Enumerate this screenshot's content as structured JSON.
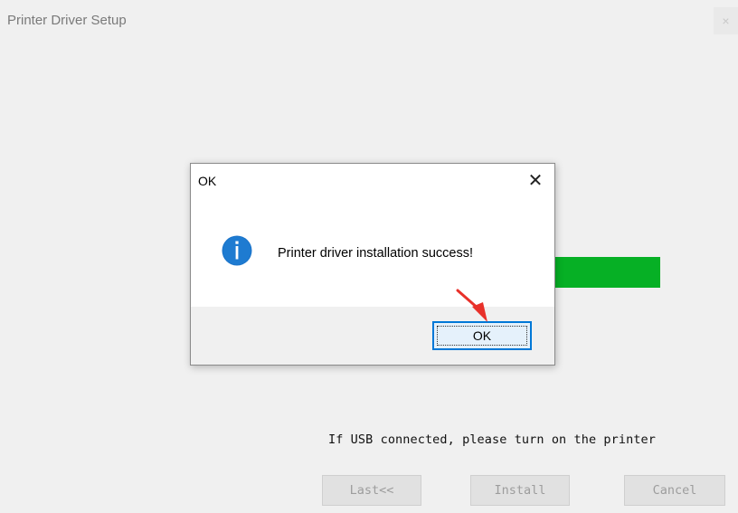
{
  "window": {
    "title": "Printer Driver Setup",
    "close_glyph": "×"
  },
  "setup": {
    "status_text": "If USB connected, please turn on the printer",
    "buttons": {
      "last": "Last<<",
      "install": "Install",
      "cancel": "Cancel"
    },
    "progress_color": "#06b025"
  },
  "dialog": {
    "title": "OK",
    "close_glyph": "✕",
    "icon": "info-icon",
    "message": "Printer driver installation success!",
    "ok_label": "OK",
    "accent": "#0078d7"
  },
  "annotation": {
    "icon": "red-arrow-icon",
    "color": "#e8312a"
  }
}
